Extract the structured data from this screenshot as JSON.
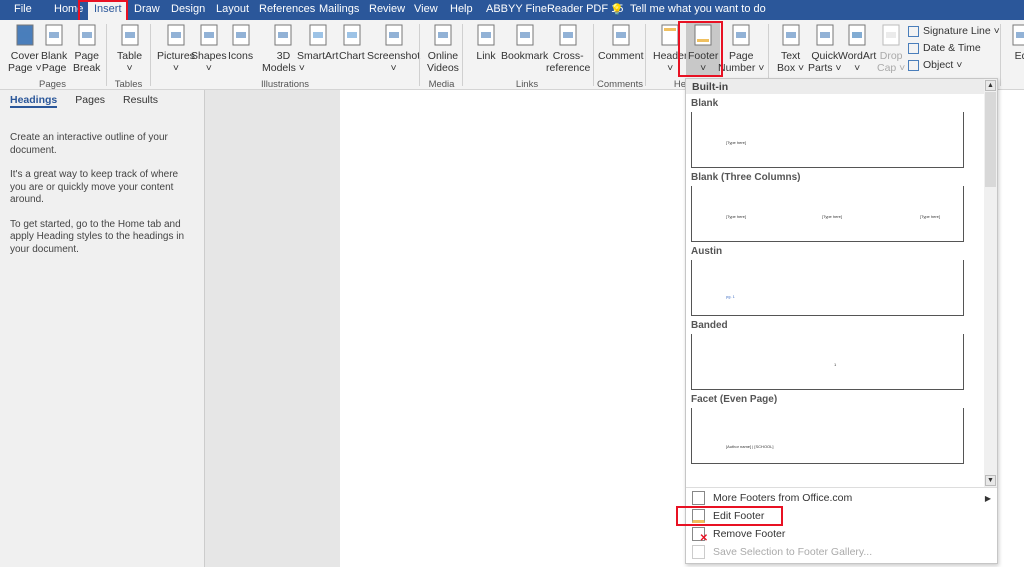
{
  "tabs": [
    "File",
    "Home",
    "Insert",
    "Draw",
    "Design",
    "Layout",
    "References",
    "Mailings",
    "Review",
    "View",
    "Help",
    "ABBYY FineReader PDF 15"
  ],
  "active_tab": "Insert",
  "tell_me": "Tell me what you want to do",
  "ribbon": {
    "buttons": [
      {
        "l1": "Cover",
        "l2": "Page ˅",
        "icon": "cover-page-icon"
      },
      {
        "l1": "Blank",
        "l2": "Page",
        "icon": "blank-page-icon"
      },
      {
        "l1": "Page",
        "l2": "Break",
        "icon": "page-break-icon"
      },
      {
        "l1": "Table",
        "l2": "˅",
        "icon": "table-icon"
      },
      {
        "l1": "Pictures",
        "l2": "˅",
        "icon": "pictures-icon"
      },
      {
        "l1": "Shapes",
        "l2": "˅",
        "icon": "shapes-icon"
      },
      {
        "l1": "Icons",
        "l2": "",
        "icon": "icons-icon"
      },
      {
        "l1": "3D",
        "l2": "Models ˅",
        "icon": "3d-models-icon"
      },
      {
        "l1": "SmartArt",
        "l2": "",
        "icon": "smartart-icon"
      },
      {
        "l1": "Chart",
        "l2": "",
        "icon": "chart-icon"
      },
      {
        "l1": "Screenshot",
        "l2": "˅",
        "icon": "screenshot-icon"
      },
      {
        "l1": "Online",
        "l2": "Videos",
        "icon": "online-videos-icon"
      },
      {
        "l1": "Link",
        "l2": "",
        "icon": "link-icon"
      },
      {
        "l1": "Bookmark",
        "l2": "",
        "icon": "bookmark-icon"
      },
      {
        "l1": "Cross-",
        "l2": "reference",
        "icon": "cross-reference-icon"
      },
      {
        "l1": "Comment",
        "l2": "",
        "icon": "comment-icon"
      },
      {
        "l1": "Header",
        "l2": "˅",
        "icon": "header-icon"
      },
      {
        "l1": "Footer",
        "l2": "˅",
        "icon": "footer-icon"
      },
      {
        "l1": "Page",
        "l2": "Number ˅",
        "icon": "page-number-icon"
      },
      {
        "l1": "Text",
        "l2": "Box ˅",
        "icon": "text-box-icon"
      },
      {
        "l1": "Quick",
        "l2": "Parts ˅",
        "icon": "quick-parts-icon"
      },
      {
        "l1": "WordArt",
        "l2": "˅",
        "icon": "wordart-icon"
      },
      {
        "l1": "Drop",
        "l2": "Cap ˅",
        "icon": "drop-cap-icon"
      },
      {
        "l1": "Eq",
        "l2": "",
        "icon": "equation-icon"
      }
    ],
    "groups": [
      "Pages",
      "Tables",
      "Illustrations",
      "Media",
      "Links",
      "Comments",
      "He"
    ],
    "small": [
      "Signature Line ˅",
      "Date & Time",
      "Object ˅"
    ]
  },
  "nav": {
    "tabs": [
      "Headings",
      "Pages",
      "Results"
    ],
    "paras": [
      "Create an interactive outline of your document.",
      "It's a great way to keep track of where you are or quickly move your content around.",
      "To get started, go to the Home tab and apply Heading styles to the headings in your document."
    ]
  },
  "dropdown": {
    "header": "Built-in",
    "gallery": [
      {
        "name": "Blank",
        "texts": [
          "[Type here]"
        ]
      },
      {
        "name": "Blank (Three Columns)",
        "texts": [
          "[Type here]",
          "[Type here]",
          "[Type here]"
        ]
      },
      {
        "name": "Austin",
        "texts": [
          "pg. 1"
        ]
      },
      {
        "name": "Banded",
        "texts": [
          "1"
        ]
      },
      {
        "name": "Facet (Even Page)",
        "texts": [
          "[Author name] | [SCHOOL]"
        ]
      }
    ],
    "menu": [
      "More Footers from Office.com",
      "Edit Footer",
      "Remove Footer",
      "Save Selection to Footer Gallery..."
    ]
  },
  "colors": {
    "accent": "#2b579a",
    "highlight": "#e81123"
  }
}
